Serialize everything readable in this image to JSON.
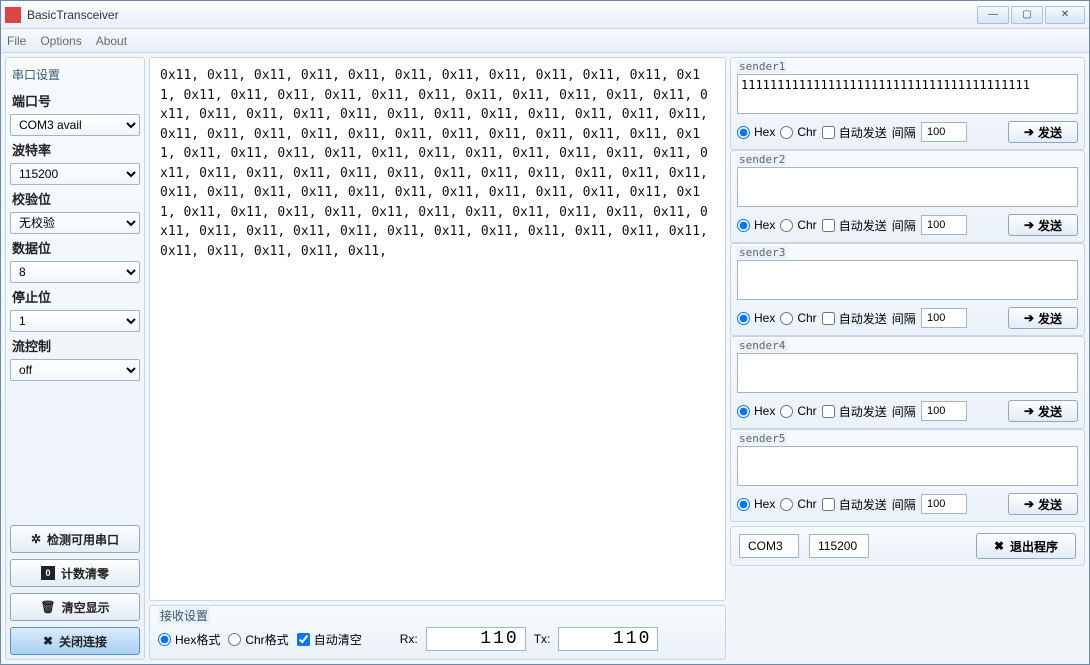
{
  "window": {
    "title": "BasicTransceiver"
  },
  "menu": {
    "file": "File",
    "options": "Options",
    "about": "About"
  },
  "sidebar": {
    "group_label": "串口设置",
    "port_label": "端口号",
    "port_value": "COM3  avail",
    "baud_label": "波特率",
    "baud_value": "115200",
    "parity_label": "校验位",
    "parity_value": "无校验",
    "databits_label": "数据位",
    "databits_value": "8",
    "stopbits_label": "停止位",
    "stopbits_value": "1",
    "flow_label": "流控制",
    "flow_value": "off",
    "btn_detect": "检测可用串口",
    "btn_reset": "计数清零",
    "btn_clear": "清空显示",
    "btn_close": "关闭连接"
  },
  "receive": {
    "text": "0x11, 0x11, 0x11, 0x11, 0x11, 0x11, 0x11, 0x11, 0x11, 0x11, 0x11, 0x11, 0x11, 0x11, 0x11, 0x11, 0x11, 0x11, 0x11, 0x11, 0x11, 0x11, 0x11, 0x11, 0x11, 0x11, 0x11, 0x11, 0x11, 0x11, 0x11, 0x11, 0x11, 0x11, 0x11, 0x11, 0x11, 0x11, 0x11, 0x11, 0x11, 0x11, 0x11, 0x11, 0x11, 0x11, 0x11, 0x11, 0x11, 0x11, 0x11, 0x11, 0x11, 0x11, 0x11, 0x11, 0x11, 0x11, 0x11, 0x11, 0x11, 0x11, 0x11, 0x11, 0x11, 0x11, 0x11, 0x11, 0x11, 0x11, 0x11, 0x11, 0x11, 0x11, 0x11, 0x11, 0x11, 0x11, 0x11, 0x11, 0x11, 0x11, 0x11, 0x11, 0x11, 0x11, 0x11, 0x11, 0x11, 0x11, 0x11, 0x11, 0x11, 0x11, 0x11, 0x11, 0x11, 0x11, 0x11, 0x11, 0x11, 0x11, 0x11, 0x11, 0x11, 0x11, 0x11, 0x11, 0x11, 0x11,",
    "settings_label": "接收设置",
    "hex_label": "Hex格式",
    "chr_label": "Chr格式",
    "autoclear_label": "自动清空",
    "rx_label": "Rx:",
    "rx_value": "110",
    "tx_label": "Tx:",
    "tx_value": "110",
    "format_selected": "hex",
    "autoclear_checked": true
  },
  "senders": [
    {
      "legend": "sender1",
      "text": "1111111111111111111111111111111111111111",
      "hex": true,
      "auto": false,
      "interval": "100"
    },
    {
      "legend": "sender2",
      "text": "",
      "hex": true,
      "auto": false,
      "interval": "100"
    },
    {
      "legend": "sender3",
      "text": "",
      "hex": true,
      "auto": false,
      "interval": "100"
    },
    {
      "legend": "sender4",
      "text": "",
      "hex": true,
      "auto": false,
      "interval": "100"
    },
    {
      "legend": "sender5",
      "text": "",
      "hex": true,
      "auto": false,
      "interval": "100"
    }
  ],
  "sender_labels": {
    "hex": "Hex",
    "chr": "Chr",
    "auto": "自动发送",
    "interval": "间隔",
    "send": "发送"
  },
  "status": {
    "port": "COM3",
    "baud": "115200",
    "exit": "退出程序"
  }
}
